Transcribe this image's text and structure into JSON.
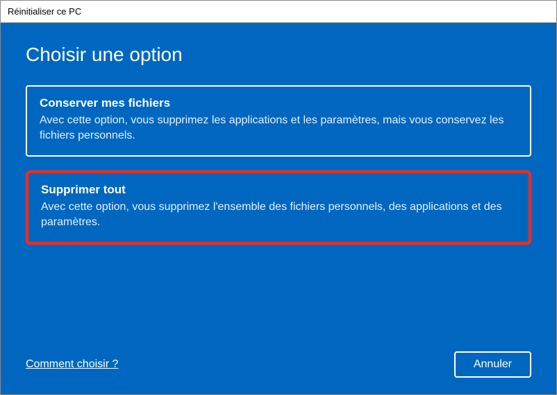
{
  "window": {
    "title": "Réinitialiser ce PC"
  },
  "page": {
    "title": "Choisir une option"
  },
  "options": {
    "keep": {
      "title": "Conserver mes fichiers",
      "desc": "Avec cette option, vous supprimez les applications et les paramètres, mais vous conservez les fichiers personnels."
    },
    "remove": {
      "title": "Supprimer tout",
      "desc": "Avec cette option, vous supprimez l'ensemble des fichiers personnels, des applications et des paramètres."
    }
  },
  "footer": {
    "help_link": "Comment choisir ?",
    "cancel_label": "Annuler"
  },
  "colors": {
    "background": "#0067c0",
    "highlight_border": "#ff2a1a"
  }
}
